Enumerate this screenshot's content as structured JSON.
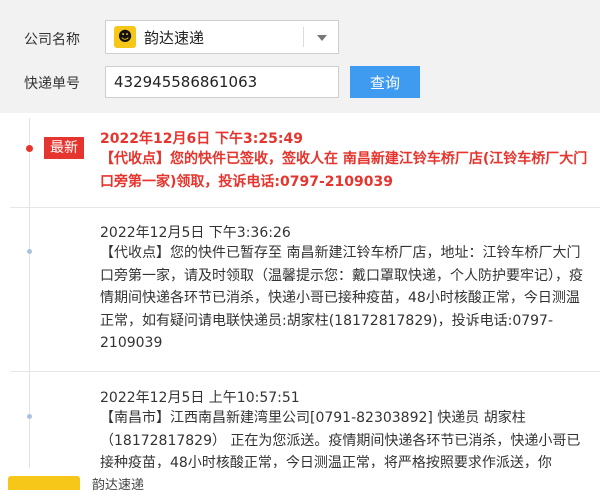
{
  "form": {
    "company_label": "公司名称",
    "company_value": "韵达速递",
    "company_icon": "yunda-logo-icon",
    "tracking_label": "快递单号",
    "tracking_value": "432945586861063",
    "query_button": "查询"
  },
  "timeline": {
    "latest_badge": "最新",
    "events": [
      {
        "time": "2022年12月6日 下午3:25:49",
        "message": "【代收点】您的快件已签收，签收人在 南昌新建江铃车桥厂店(江铃车桥厂大门口旁第一家)领取，投诉电话:0797-2109039"
      },
      {
        "time": "2022年12月5日 下午3:36:26",
        "message": "【代收点】您的快件已暂存至 南昌新建江铃车桥厂店，地址：江铃车桥厂大门口旁第一家，请及时领取（温馨提示您：戴口罩取快递，个人防护要牢记），疫情期间快递各环节已消杀，快递小哥已接种疫苗，48小时核酸正常，今日测温正常，如有疑问请电联快递员:胡家柱(18172817829)，投诉电话:0797-2109039"
      },
      {
        "time": "2022年12月5日 上午10:57:51",
        "message": "【南昌市】江西南昌新建湾里公司[0791-82303892] 快递员 胡家柱（18172817829） 正在为您派送。疫情期间快递各环节已消杀，快递小哥已接种疫苗，48小时核酸正常，今日测温正常，将严格按照要求作派送，你"
      }
    ]
  },
  "footer": {
    "company_text": "韵达速递"
  },
  "colors": {
    "accent_red": "#e5352e",
    "button_blue": "#3e9bf0",
    "brand_yellow": "#f6c619"
  }
}
